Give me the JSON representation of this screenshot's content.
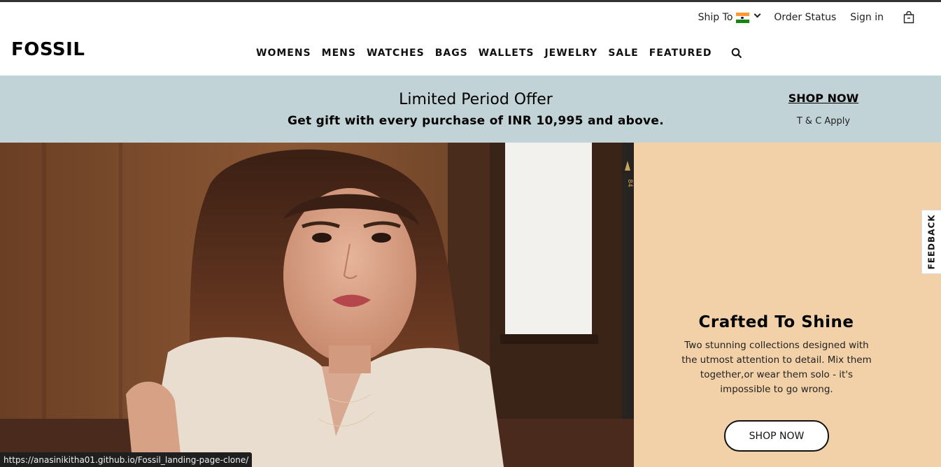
{
  "utility": {
    "ship_to": "Ship To",
    "order_status": "Order Status",
    "sign_in": "Sign in"
  },
  "brand": {
    "logo": "FOSSIL"
  },
  "nav": {
    "items": [
      "WOMENS",
      "MENS",
      "WATCHES",
      "BAGS",
      "WALLETS",
      "JEWELRY",
      "SALE",
      "FEATURED"
    ]
  },
  "promo": {
    "title": "Limited Period Offer",
    "subtitle": "Get gift with every purchase of INR 10,995 and above.",
    "cta": "SHOP NOW",
    "terms": "T & C Apply"
  },
  "hero": {
    "film_marker": "84",
    "title": "Crafted To Shine",
    "copy": "Two stunning collections designed with the utmost attention to detail. Mix them together,or wear them solo - it's impossible to go wrong.",
    "cta": "SHOP NOW"
  },
  "feedback": {
    "label": "FEEDBACK"
  },
  "status_bar": {
    "url": "https://anasinikitha01.github.io/Fossil_landing-page-clone/"
  },
  "colors": {
    "promo_bg": "#c1d3d6",
    "panel_bg": "#f2d0a8",
    "text": "#111111"
  },
  "icons": [
    "india-flag-icon",
    "chevron-down-icon",
    "shopping-bag-icon",
    "search-icon"
  ]
}
